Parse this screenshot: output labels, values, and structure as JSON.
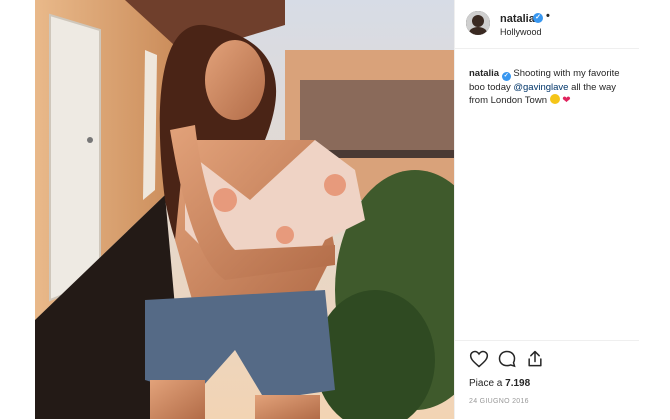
{
  "post": {
    "username": "natalia",
    "location": "Hollywood",
    "caption": {
      "username": "natalia",
      "text_1": "Shooting with my favorite boo today",
      "mention": "@gavinglave",
      "text_2": "all the way from London Town"
    },
    "likes_label": "Piace a",
    "likes_count": "7.198",
    "date": "24 GIUGNO 2016"
  },
  "colors": {
    "verified": "#3897f0",
    "mention": "#003569",
    "text": "#262626",
    "muted": "#999999"
  },
  "icons": [
    "verified-badge-icon",
    "more-dot-icon",
    "heart-icon",
    "comment-icon",
    "share-icon",
    "smiling-face-icon",
    "heart-emoji-icon"
  ]
}
